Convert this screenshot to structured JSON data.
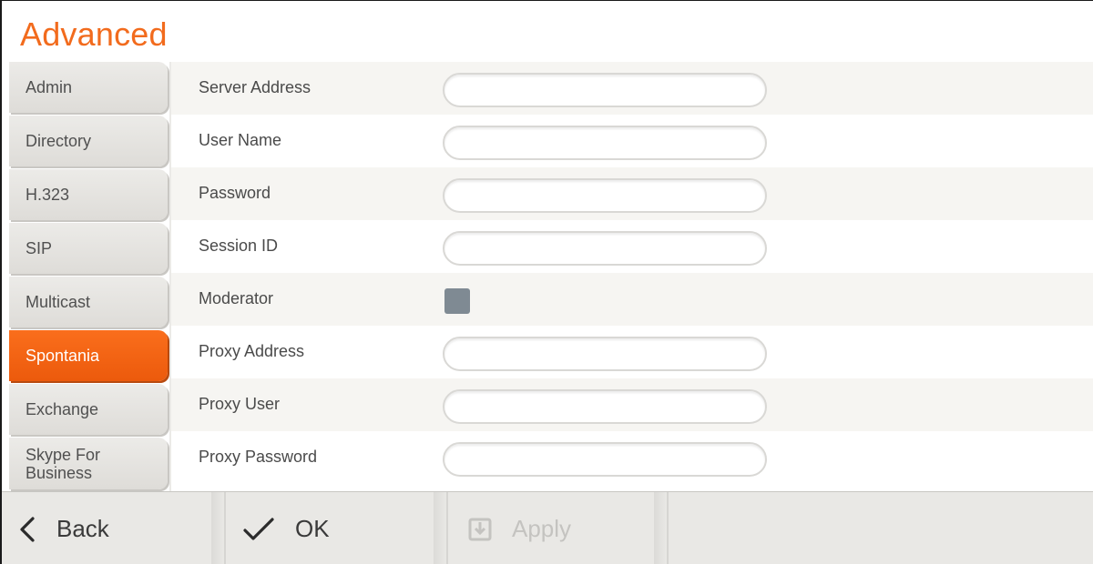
{
  "window": {
    "title": "Advanced"
  },
  "sidebar": {
    "items": [
      {
        "label": "Admin",
        "active": false
      },
      {
        "label": "Directory",
        "active": false
      },
      {
        "label": "H.323",
        "active": false
      },
      {
        "label": "SIP",
        "active": false
      },
      {
        "label": "Multicast",
        "active": false
      },
      {
        "label": "Spontania",
        "active": true
      },
      {
        "label": "Exchange",
        "active": false
      },
      {
        "label_line1": "Skype For",
        "label_line2": "Business",
        "active": false
      }
    ]
  },
  "form": {
    "fields": [
      {
        "label": "Server Address",
        "value": "",
        "type": "text"
      },
      {
        "label": "User Name",
        "value": "",
        "type": "text"
      },
      {
        "label": "Password",
        "value": "",
        "type": "password"
      },
      {
        "label": "Session ID",
        "value": "",
        "type": "text"
      },
      {
        "label": "Moderator",
        "checked": false,
        "type": "checkbox"
      },
      {
        "label": "Proxy Address",
        "value": "",
        "type": "text"
      },
      {
        "label": "Proxy User",
        "value": "",
        "type": "text"
      },
      {
        "label": "Proxy Password",
        "value": "",
        "type": "password"
      }
    ]
  },
  "toolbar": {
    "back_label": "Back",
    "back_icon": "chevron-left-icon",
    "ok_label": "OK",
    "ok_icon": "checkmark-icon",
    "apply_label": "Apply",
    "apply_icon": "save-icon",
    "apply_enabled": false
  },
  "colors": {
    "accent": "#f26b1d",
    "active_tab": "#f36a1a",
    "checkbox": "#7f8a93",
    "disabled_text": "#c4c3c0"
  }
}
